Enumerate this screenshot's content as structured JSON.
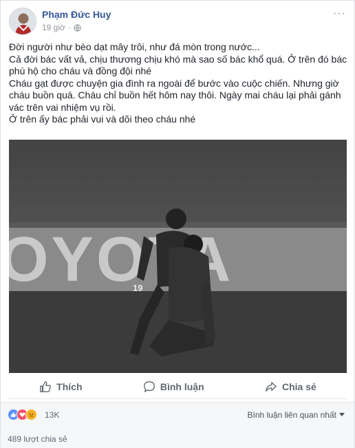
{
  "post": {
    "author": "Phạm Đức Huy",
    "time": "19 giờ",
    "more_label": "···",
    "text_lines": [
      "Đời người như bèo dạt mây trôi, như đá mòn trong nước...",
      "Cả đời bác vất vả, chịu thương chịu khó mà sao số bác khổ quá. Ở trên đó bác",
      "phù hộ cho cháu và đồng đội nhé",
      "Cháu gạt được chuyện gia đình ra ngoài để bước vào cuộc chiến. Nhưng giờ",
      "cháu buồn quá. Cháu chỉ buồn hết hôm nay thôi. Ngày mai cháu lại phải gánh",
      "vác trên vai nhiệm vụ rồi.",
      "Ở trên ấy bác phải vui và dõi theo cháu nhé"
    ],
    "photo": {
      "banner_text": "OYOTA",
      "jersey_number": "19"
    }
  },
  "actions": {
    "like": "Thích",
    "comment": "Bình luận",
    "share": "Chia sẻ"
  },
  "reactions": {
    "icons": [
      "like-reaction",
      "love-reaction",
      "sad-reaction"
    ],
    "count": "13K",
    "sort_label": "Bình luận liên quan nhất",
    "shares": "489 lượt chia sẻ"
  },
  "colors": {
    "link": "#365899",
    "like_blue": "#5890ff",
    "love_red": "#f25268",
    "sad_yellow": "#f7b125"
  }
}
